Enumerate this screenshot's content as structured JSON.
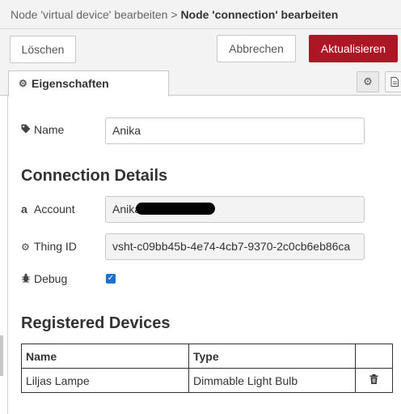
{
  "breadcrumb": {
    "parent": "Node 'virtual device' bearbeiten",
    "separator": ">",
    "current": "Node 'connection' bearbeiten"
  },
  "buttons": {
    "delete": "Löschen",
    "cancel": "Abbrechen",
    "update": "Aktualisieren"
  },
  "tabs": {
    "properties": "Eigenschaften",
    "properties_icon": "gear-icon",
    "side_icons": [
      "gear-icon",
      "document-icon"
    ]
  },
  "form": {
    "name_label": "Name",
    "name_value": "Anika",
    "section_connection": "Connection Details",
    "account_label": "Account",
    "account_value": "Anika",
    "thing_id_label": "Thing ID",
    "thing_id_value": "vsht-c09bb45b-4e74-4cb7-9370-2c0cb6eb86ca",
    "debug_label": "Debug",
    "debug_checked": true
  },
  "devices": {
    "section_title": "Registered Devices",
    "columns": [
      "Name",
      "Type",
      ""
    ],
    "rows": [
      {
        "name": "Liljas Lampe",
        "type": "Dimmable Light Bulb"
      }
    ]
  },
  "colors": {
    "accent": "#ad1625",
    "checkbox": "#1f6fd1"
  }
}
